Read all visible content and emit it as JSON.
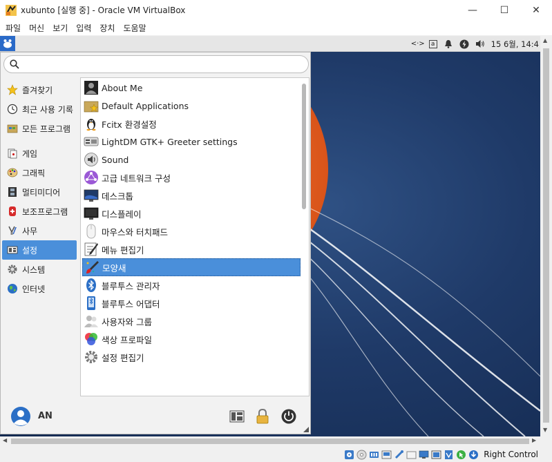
{
  "window": {
    "title": "xubunto [실행 중] - Oracle VM VirtualBox",
    "minimize": "—",
    "maximize": "☐",
    "close": "✕"
  },
  "vbox_menu": [
    "파일",
    "머신",
    "보기",
    "입력",
    "장치",
    "도움말"
  ],
  "panel": {
    "tray_text_a": "<·>",
    "tray_text_b": "a",
    "clock": "15 6월, 14:4"
  },
  "search": {
    "value": "",
    "placeholder": ""
  },
  "categories": [
    {
      "label": "즐겨찾기",
      "icon": "star-icon"
    },
    {
      "label": "최근 사용 기록",
      "icon": "clock-icon"
    },
    {
      "label": "모든 프로그램",
      "icon": "folder-icon"
    },
    {
      "label": "게임",
      "icon": "cards-icon"
    },
    {
      "label": "그래픽",
      "icon": "palette-icon"
    },
    {
      "label": "멀티미디어",
      "icon": "film-icon"
    },
    {
      "label": "보조프로그램",
      "icon": "knife-icon"
    },
    {
      "label": "사무",
      "icon": "pen-icon"
    },
    {
      "label": "설정",
      "icon": "settings-icon",
      "selected": true
    },
    {
      "label": "시스템",
      "icon": "gear-icon"
    },
    {
      "label": "인터넷",
      "icon": "globe-icon"
    }
  ],
  "apps": [
    {
      "label": "About Me",
      "icon": "user-card-icon"
    },
    {
      "label": "Default Applications",
      "icon": "star-folder-icon"
    },
    {
      "label": "Fcitx 환경설정",
      "icon": "penguin-icon"
    },
    {
      "label": "LightDM GTK+ Greeter settings",
      "icon": "display-settings-icon"
    },
    {
      "label": "Sound",
      "icon": "speaker-icon"
    },
    {
      "label": "고급 네트워크 구성",
      "icon": "network-icon"
    },
    {
      "label": "데스크톱",
      "icon": "desktop-icon"
    },
    {
      "label": "디스플레이",
      "icon": "monitor-icon"
    },
    {
      "label": "마우스와 터치패드",
      "icon": "mouse-icon"
    },
    {
      "label": "메뉴 편집기",
      "icon": "menu-editor-icon"
    },
    {
      "label": "모양새",
      "icon": "brush-icon",
      "selected": true
    },
    {
      "label": "블루투스 관리자",
      "icon": "bluetooth-icon"
    },
    {
      "label": "블루투스 어댑터",
      "icon": "phone-icon"
    },
    {
      "label": "사용자와 그룹",
      "icon": "users-icon"
    },
    {
      "label": "색상 프로파일",
      "icon": "color-icon"
    },
    {
      "label": "설정 편집기",
      "icon": "gear-icon"
    }
  ],
  "user": {
    "name": "AN"
  },
  "status": {
    "host_key": "Right Control"
  },
  "colors": {
    "selection": "#4a8fda",
    "panel": "#e6e6e6",
    "desktop": "#1f3a68",
    "sun": "#e8631c"
  }
}
